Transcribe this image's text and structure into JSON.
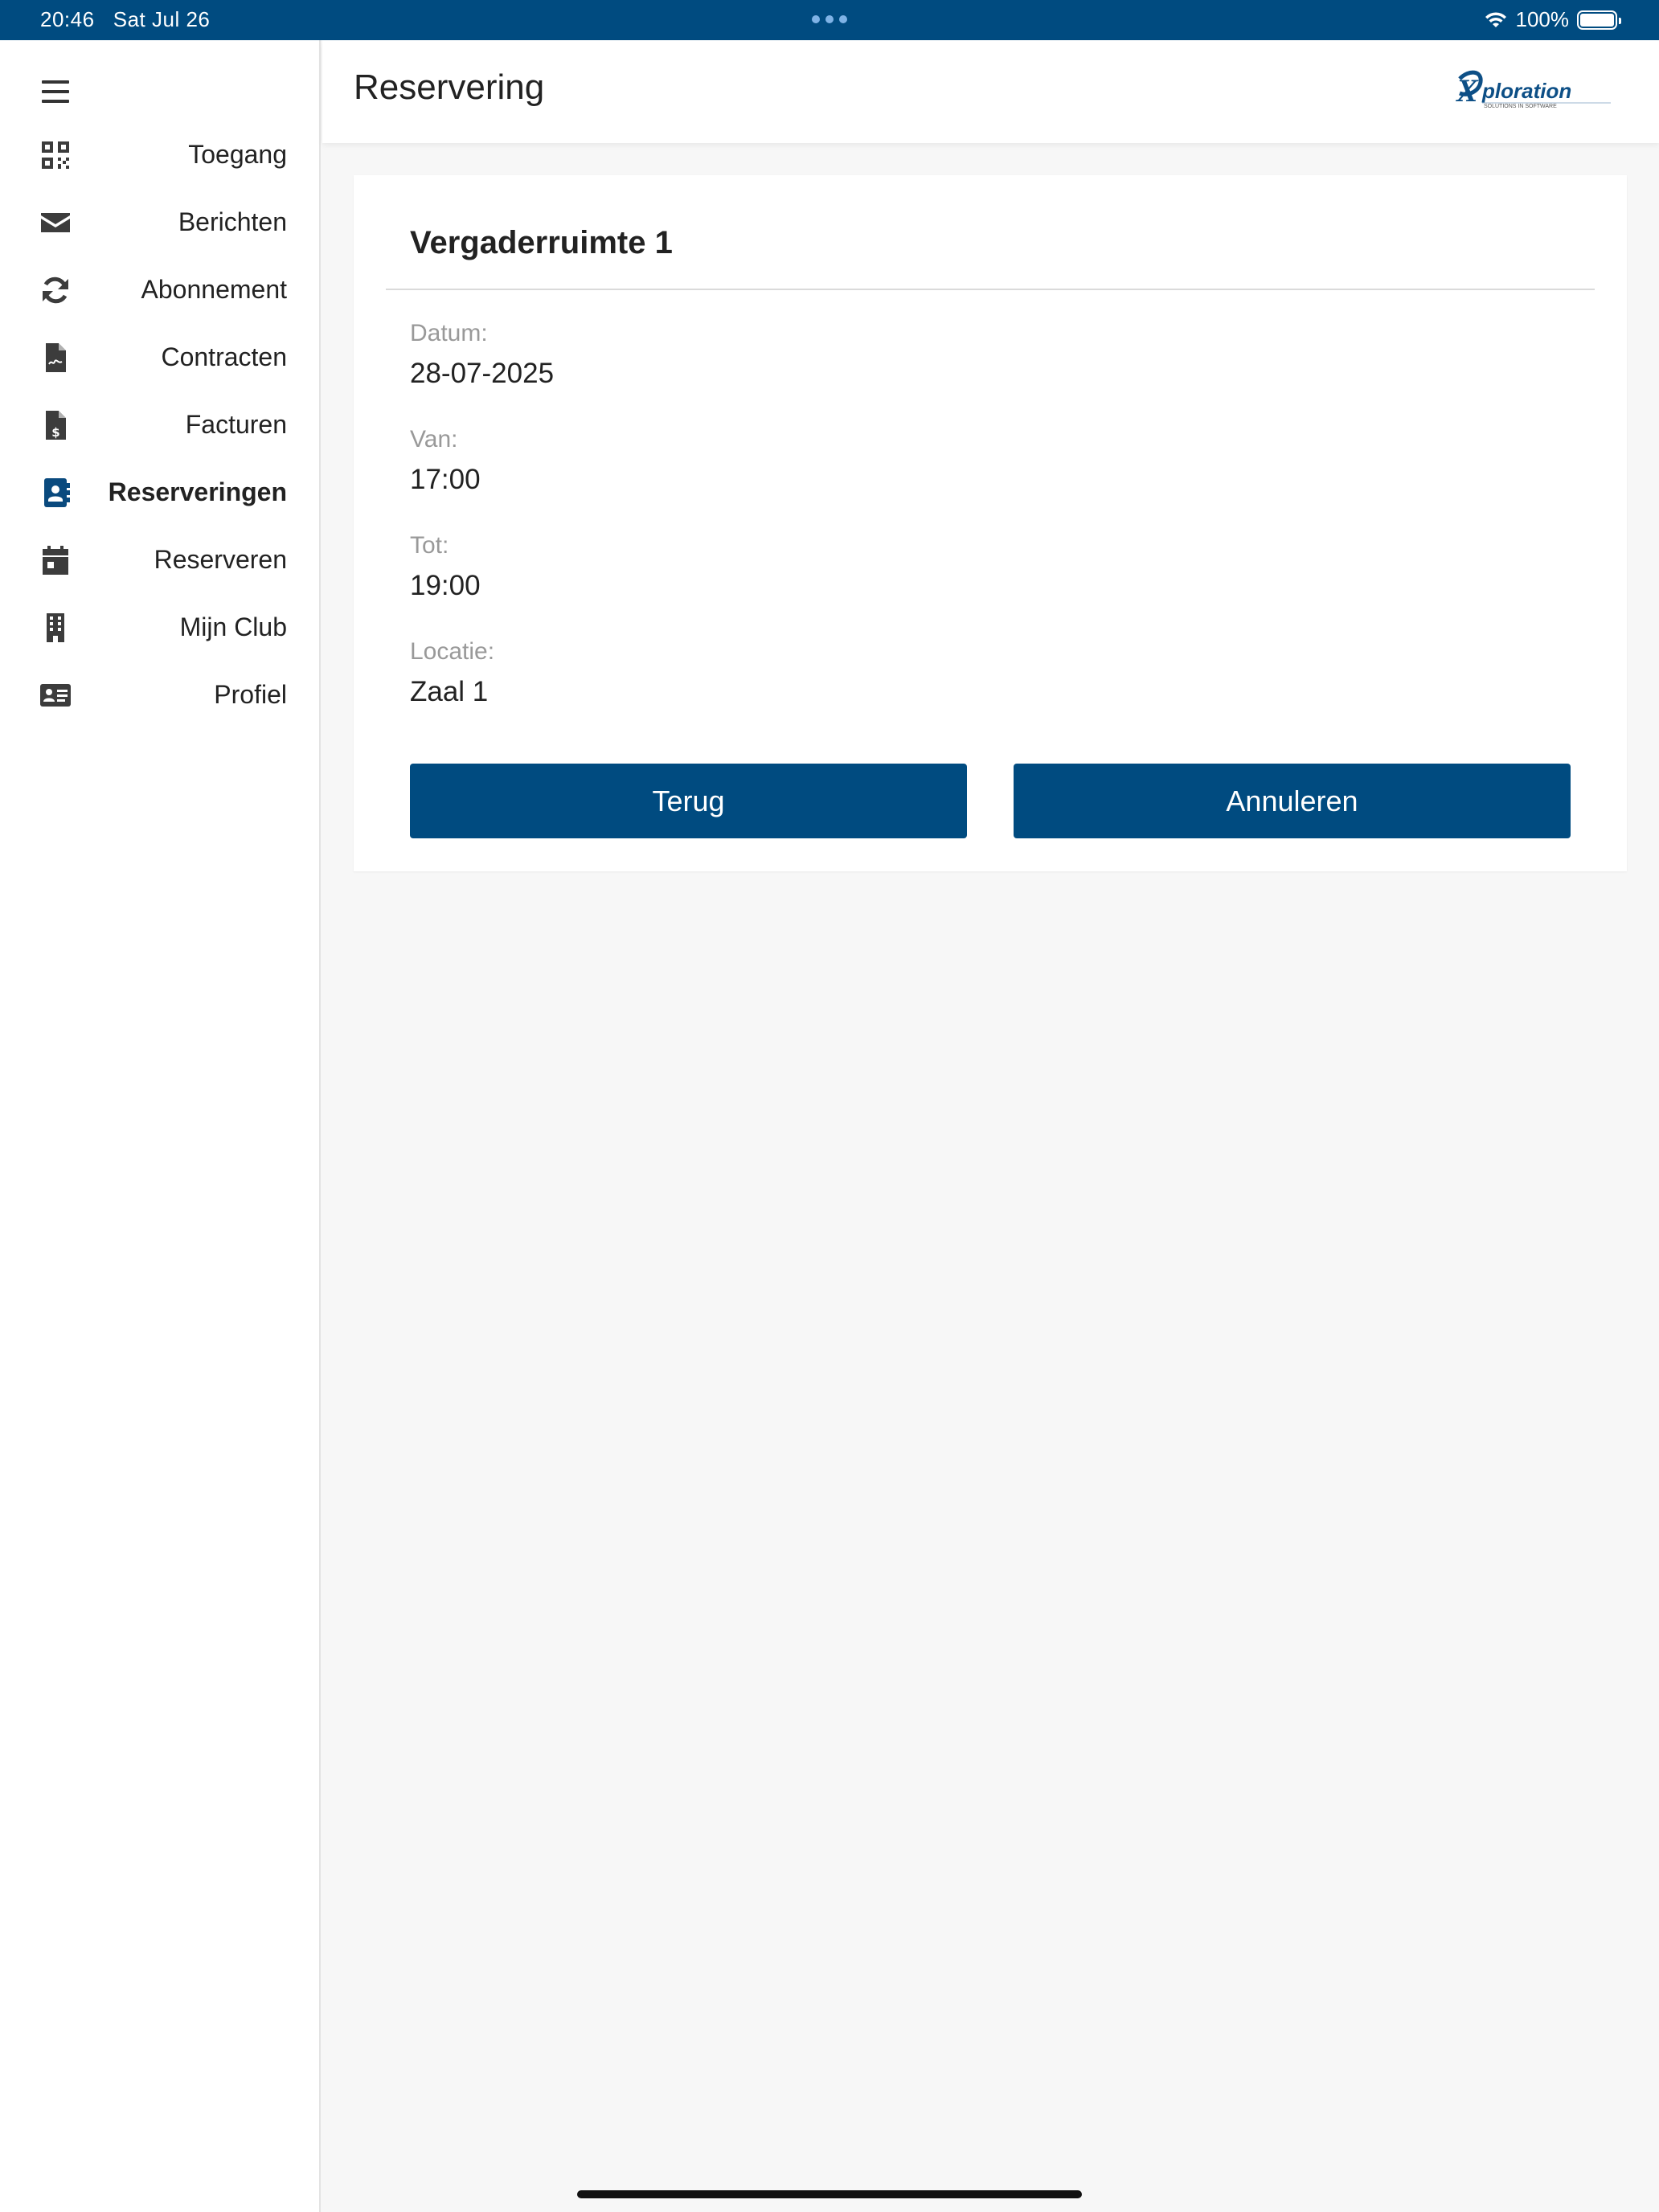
{
  "status_bar": {
    "time": "20:46",
    "date": "Sat Jul 26",
    "battery": "100%",
    "battery_level": 1.0,
    "wifi_icon": "wifi-icon"
  },
  "sidebar": {
    "menu_icon": "hamburger-icon",
    "items": [
      {
        "label": "Toegang",
        "icon": "qr-code-icon",
        "active": false
      },
      {
        "label": "Berichten",
        "icon": "envelope-icon",
        "active": false
      },
      {
        "label": "Abonnement",
        "icon": "refresh-icon",
        "active": false
      },
      {
        "label": "Contracten",
        "icon": "contract-file-icon",
        "active": false
      },
      {
        "label": "Facturen",
        "icon": "invoice-file-icon",
        "active": false
      },
      {
        "label": "Reserveringen",
        "icon": "address-book-icon",
        "active": true
      },
      {
        "label": "Reserveren",
        "icon": "calendar-icon",
        "active": false
      },
      {
        "label": "Mijn Club",
        "icon": "building-icon",
        "active": false
      },
      {
        "label": "Profiel",
        "icon": "id-card-icon",
        "active": false
      }
    ]
  },
  "header": {
    "title": "Reservering",
    "logo_text": "ploration",
    "logo_tagline": "SOLUTIONS IN SOFTWARE"
  },
  "reservation": {
    "title": "Vergaderruimte 1",
    "fields": [
      {
        "label": "Datum:",
        "value": "28-07-2025"
      },
      {
        "label": "Van:",
        "value": "17:00"
      },
      {
        "label": "Tot:",
        "value": "19:00"
      },
      {
        "label": "Locatie:",
        "value": "Zaal 1"
      }
    ],
    "back_label": "Terug",
    "cancel_label": "Annuleren"
  },
  "colors": {
    "primary": "#004b80",
    "status_bar": "#004b80",
    "background": "#f7f7f7"
  }
}
